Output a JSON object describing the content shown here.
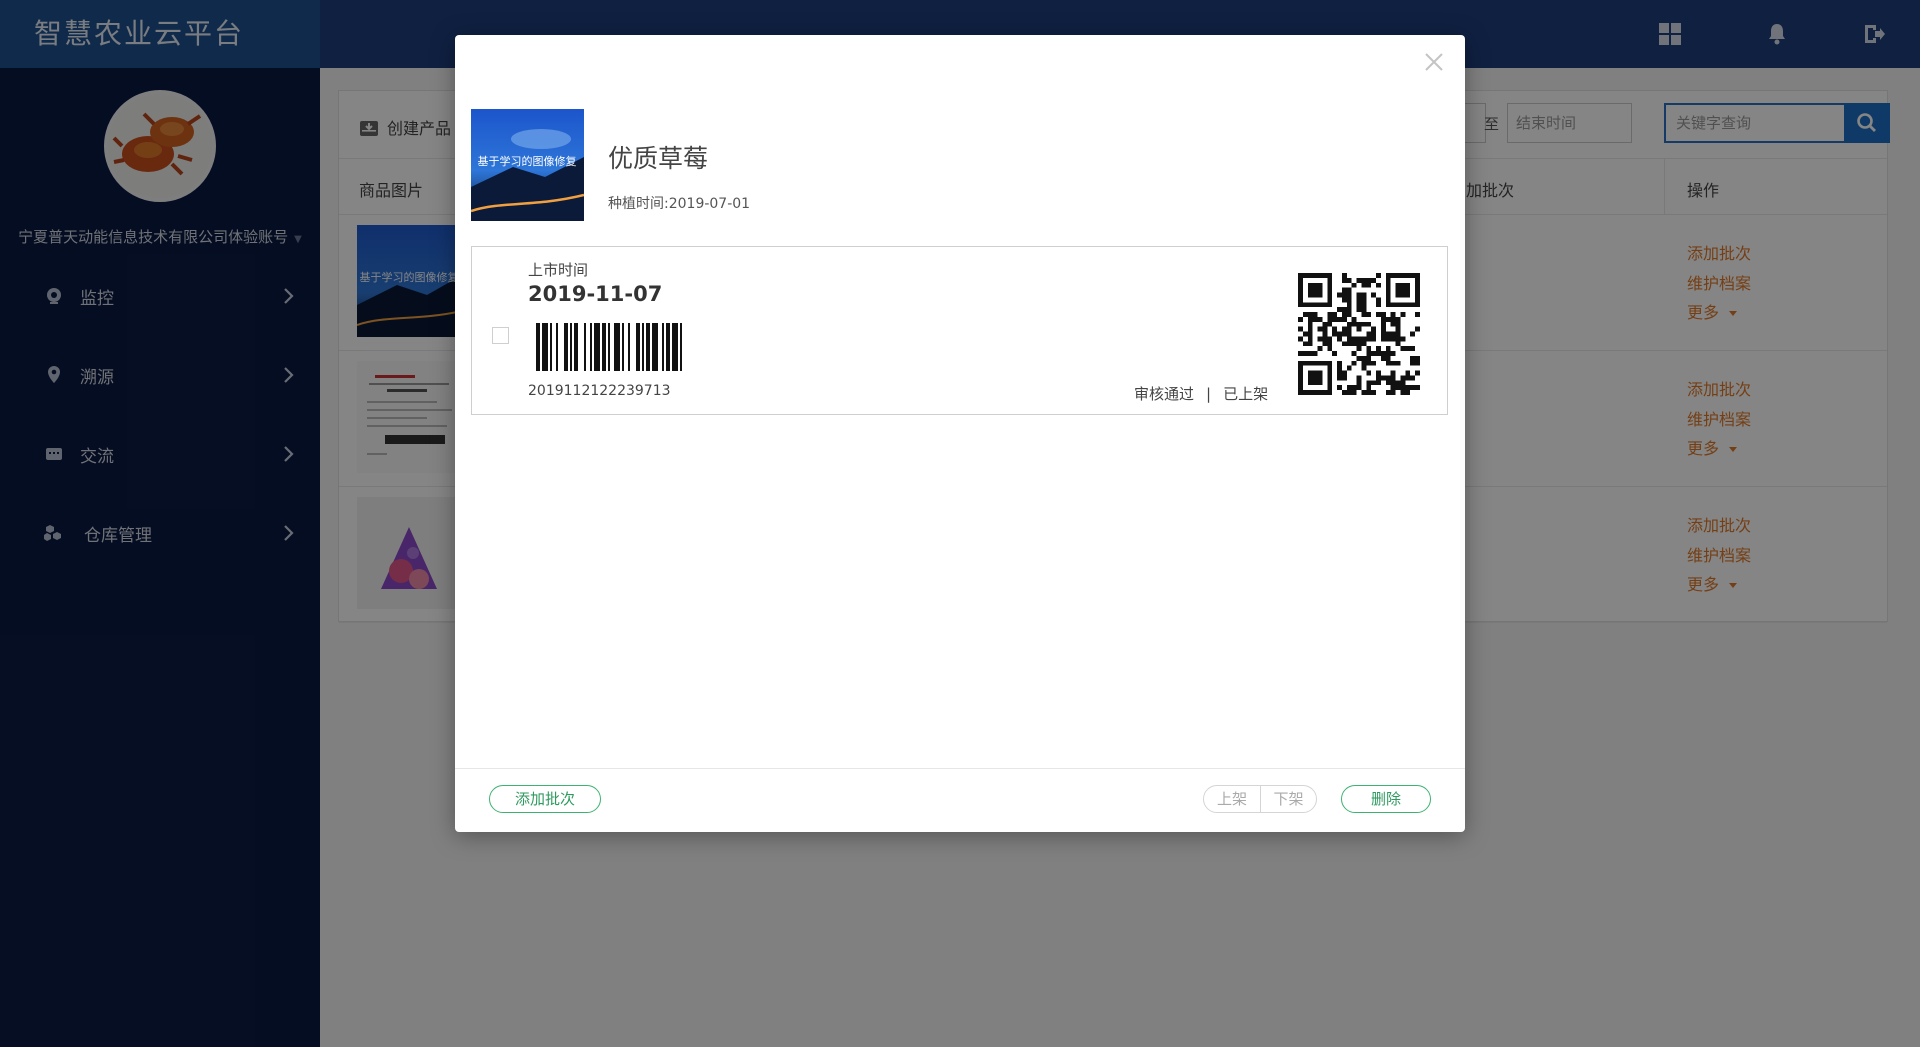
{
  "header": {
    "app_title": "智慧农业云平台",
    "icons": [
      "grid-icon",
      "bell-icon",
      "logout-icon"
    ]
  },
  "sidebar": {
    "company": "宁夏普天动能信息技术有限公司体验账号",
    "items": [
      {
        "label": "监控",
        "icon": "camera-icon"
      },
      {
        "label": "溯源",
        "icon": "location-pin-icon"
      },
      {
        "label": "交流",
        "icon": "chat-icon"
      },
      {
        "label": "仓库管理",
        "icon": "warehouse-icon"
      }
    ]
  },
  "main": {
    "create_label": "创建产品",
    "to_label": "至",
    "end_time_placeholder": "结束时间",
    "search_placeholder": "关键字查询",
    "columns": {
      "image": "商品图片",
      "batch": "加批次",
      "ops": "操作"
    },
    "thumbnail_text": "基于学习的图像修复",
    "row_ops": {
      "add_batch": "添加批次",
      "maintain": "维护档案",
      "more": "更多"
    }
  },
  "modal": {
    "product_name": "优质草莓",
    "plant_time": "种植时间:2019-07-01",
    "image_text": "基于学习的图像修复",
    "batch": {
      "label": "上市时间",
      "date": "2019-11-07",
      "code": "2019112122239713",
      "review_status": "审核通过",
      "separator": "|",
      "shelf_status": "已上架"
    },
    "footer": {
      "add_batch": "添加批次",
      "on_shelf": "上架",
      "off_shelf": "下架",
      "delete": "删除"
    }
  },
  "colors": {
    "header": "#1d3f7e",
    "sidebar": "#0a1a41",
    "accent_green": "#3cb371",
    "link_orange": "#e07a2a",
    "search_blue": "#1e6fc6"
  }
}
